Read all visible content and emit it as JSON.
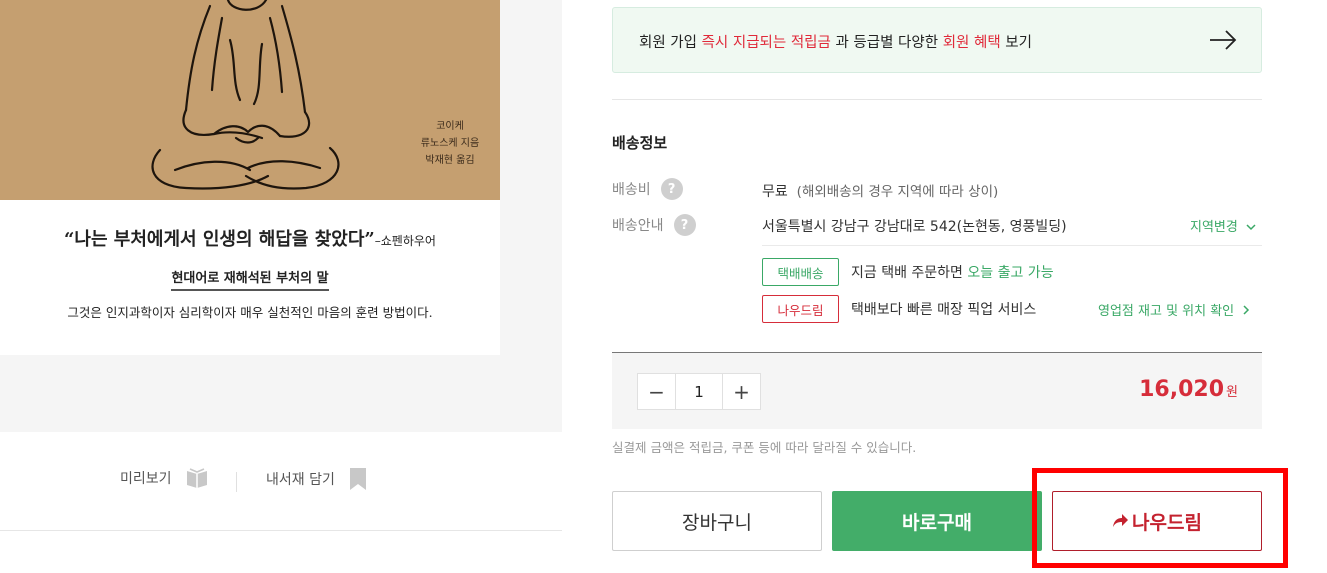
{
  "cover": {
    "authors": [
      "코이케",
      "류노스케 지음",
      "박재현 옮김"
    ],
    "quote": "“나는 부처에게서 인생의 해답을 찾았다”",
    "quote_attribution": "–쇼펜하우어",
    "subtitle": "현대어로 재해석된 부처의 말",
    "description": "그것은 인지과학이자 심리학이자 매우 실천적인 마음의 훈련 방법이다."
  },
  "cover_actions": {
    "preview_label": "미리보기",
    "wishlist_label": "내서재 담기",
    "preview_icon": "book-icon",
    "wishlist_icon": "bookmark-icon"
  },
  "promo": {
    "part1": "회원 가입 ",
    "highlight1": "즉시 지급되는 적립금",
    "part2": " 과 등급별 다양한 ",
    "highlight2": "회원 혜택",
    "part3": " 보기",
    "icon": "arrow-right-icon"
  },
  "shipping": {
    "title": "배송정보",
    "fee_label": "배송비",
    "fee_value": "무료",
    "fee_note": "(해외배송의 경우 지역에 따라 상이)",
    "guide_label": "배송안내",
    "address": "서울특별시 강남구 강남대로 542(논현동, 영풍빌딩)",
    "region_change": "지역변경",
    "help_icon": "?",
    "parcel_tag": "택배배송",
    "parcel_text": "지금 택배 주문하면 ",
    "parcel_highlight": "오늘 출고 가능",
    "nowdrim_tag": "나우드림",
    "nowdrim_text": "택배보다 빠른 매장 픽업 서비스",
    "store_link": "영업점 재고 및 위치 확인"
  },
  "order": {
    "minus": "−",
    "quantity": "1",
    "plus": "+",
    "price": "16,020",
    "price_unit": "원",
    "price_note": "실결제 금액은 적립금, 쿠폰 등에 따라 달라질 수 있습니다."
  },
  "buttons": {
    "cart": "장바구니",
    "buy_now": "바로구매",
    "nowdrim": "나우드림",
    "nowdrim_icon": "share-arrow-icon"
  },
  "colors": {
    "accent_green": "#43ad69",
    "accent_red": "#d62d3a",
    "highlight_frame": "#ff0000"
  }
}
